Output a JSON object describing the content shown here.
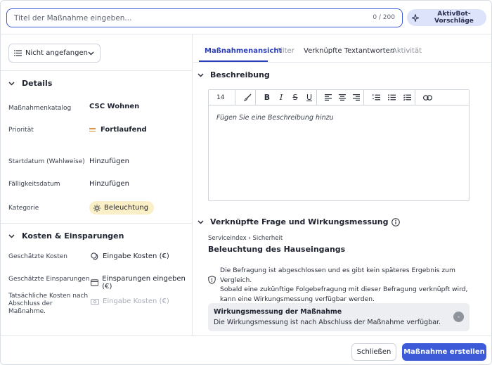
{
  "header": {
    "title_placeholder": "Titel der Maßnahme eingeben...",
    "title_value": "",
    "char_counter": "0 / 200",
    "aktivbot_label": "AktivBot-Vorschläge"
  },
  "status": {
    "selected": "Nicht angefangen"
  },
  "details": {
    "heading": "Details",
    "fields": {
      "catalog": {
        "label": "Maßnahmenkatalog",
        "value": "CSC Wohnen"
      },
      "priority": {
        "label": "Priorität",
        "value": "Fortlaufend"
      },
      "start": {
        "label": "Startdatum (Wahlweise)",
        "value": "Hinzufügen"
      },
      "due": {
        "label": "Fälligkeitsdatum",
        "value": "Hinzufügen"
      },
      "category": {
        "label": "Kategorie",
        "value": "Beleuchtung"
      }
    }
  },
  "costs": {
    "heading": "Kosten & Einsparungen",
    "estimated_costs": {
      "label": "Geschätzte Kosten",
      "value": "Eingabe Kosten (€)"
    },
    "estimated_savings": {
      "label": "Geschätzte Einsparungen",
      "value": "Einsparungen eingeben (€)"
    },
    "actual_costs": {
      "label_l1": "Tatsächliche Kosten nach",
      "label_l2": "Abschluss der",
      "label_l3": "Maßnahme.",
      "value": "Eingabe Kosten (€)"
    }
  },
  "tabs": [
    {
      "label": "Maßnahmenansicht"
    },
    {
      "label": "Filter"
    },
    {
      "label": "Verknüpfte Textantworten"
    },
    {
      "label": "Aktivität"
    }
  ],
  "description": {
    "heading": "Beschreibung",
    "font_size": "14",
    "placeholder": "Fügen Sie eine Beschreibung hinzu"
  },
  "linked": {
    "heading": "Verknüpfte Frage und Wirkungsmessung",
    "breadcrumb": "Serviceindex › Sicherheit",
    "question": "Beleuchtung des Hauseingangs",
    "info_l1": "Die Befragung ist abgeschlossen und es gibt kein späteres Ergebnis zum Vergleich.",
    "info_l2": "Sobald eine zukünftige Folgebefragung mit dieser Befragung verknüpft wird,",
    "info_l3": "kann eine Wirkungsmessung verfügbar werden.",
    "impact_title": "Wirkungsmessung der Maßnahme",
    "impact_text": "Die Wirkungsmessung ist nach Abschluss der Maßnahme verfügbar.",
    "impact_badge": "-"
  },
  "footer": {
    "close_label": "Schließen",
    "create_label": "Maßnahme erstellen"
  },
  "colors": {
    "accent": "#3d5bd9",
    "category_badge": "#fbefc8",
    "priority": "#e0913a"
  }
}
